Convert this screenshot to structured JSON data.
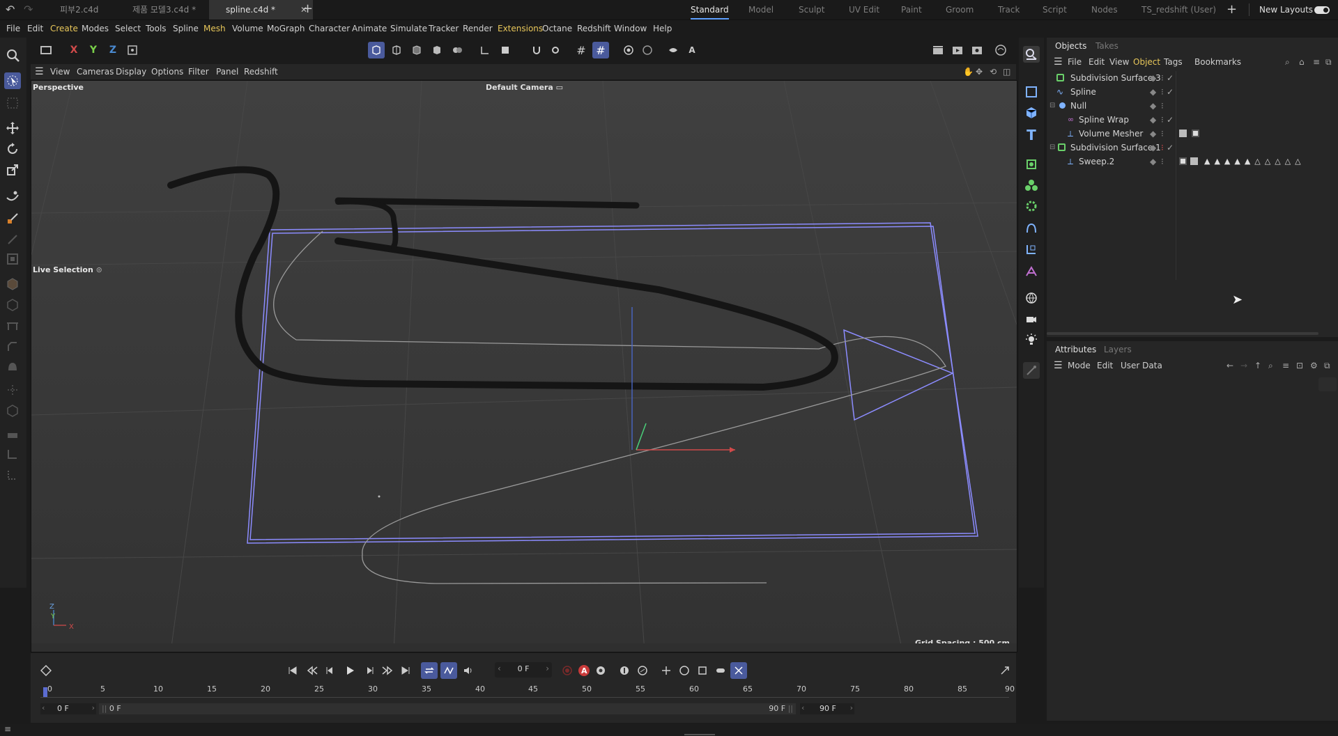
{
  "file_tabs": [
    {
      "label": "피부2.c4d",
      "active": false
    },
    {
      "label": "제품 모델3.c4d *",
      "active": false
    },
    {
      "label": "spline.c4d *",
      "active": true
    }
  ],
  "layouts": [
    "Standard",
    "Model",
    "Sculpt",
    "UV Edit",
    "Paint",
    "Groom",
    "Track",
    "Script",
    "Nodes",
    "TS_redshift (User)"
  ],
  "new_layouts_label": "New Layouts",
  "menu": [
    "File",
    "Edit",
    "Create",
    "Modes",
    "Select",
    "Tools",
    "Spline",
    "Mesh",
    "Volume",
    "MoGraph",
    "Character",
    "Animate",
    "Simulate",
    "Tracker",
    "Render",
    "Extensions",
    "Octane",
    "Redshift",
    "Window",
    "Help"
  ],
  "viewport_menu": [
    "View",
    "Cameras",
    "Display",
    "Options",
    "Filter",
    "Panel",
    "Redshift"
  ],
  "viewport": {
    "projection": "Perspective",
    "camera": "Default Camera",
    "tool_label": "Live Selection",
    "grid_spacing": "Grid Spacing : 500 cm",
    "axis_labels": {
      "x": "X",
      "y": "Y",
      "z": "Z"
    }
  },
  "coord_buttons": [
    "X",
    "Y",
    "Z"
  ],
  "objects_panel": {
    "tabs": [
      "Objects",
      "Takes"
    ],
    "menu": [
      "File",
      "Edit",
      "View",
      "Object",
      "Tags",
      "Bookmarks"
    ],
    "rows": [
      {
        "name": "Subdivision Surface.3",
        "indent": 0,
        "icon": "subdivision-icon"
      },
      {
        "name": "Spline",
        "indent": 0,
        "icon": "spline-icon"
      },
      {
        "name": "Null",
        "indent": 0,
        "icon": "null-icon"
      },
      {
        "name": "Spline Wrap",
        "indent": 1,
        "icon": "spline-wrap-icon"
      },
      {
        "name": "Volume Mesher",
        "indent": 1,
        "icon": "volume-mesher-icon"
      },
      {
        "name": "Subdivision Surface.1",
        "indent": 0,
        "icon": "subdivision-icon"
      },
      {
        "name": "Sweep.2",
        "indent": 1,
        "icon": "sweep-icon"
      }
    ]
  },
  "attributes_panel": {
    "tabs": [
      "Attributes",
      "Layers"
    ],
    "menu": [
      "Mode",
      "Edit",
      "User Data"
    ]
  },
  "timeline": {
    "current_frame": "0 F",
    "ruler_ticks": [
      "0",
      "5",
      "10",
      "15",
      "20",
      "25",
      "30",
      "35",
      "40",
      "45",
      "50",
      "55",
      "60",
      "65",
      "70",
      "75",
      "80",
      "85",
      "90"
    ],
    "start_field": "0 F",
    "range_start": "0 F",
    "range_end": "90 F",
    "end_field": "90 F"
  },
  "colors": {
    "accent": "#4a5a9c",
    "highlight_menu": "#e8c75a",
    "selection_lines": "#8c8cff",
    "spline_dark": "#151515"
  }
}
